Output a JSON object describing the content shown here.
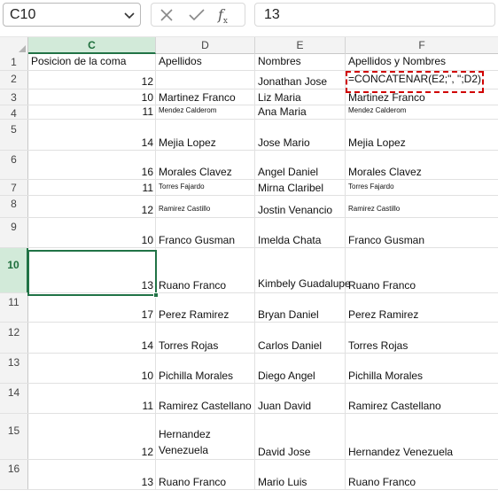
{
  "namebox": {
    "value": "C10"
  },
  "formula_bar": {
    "value": "13",
    "fx_label": "fx"
  },
  "columns": [
    "C",
    "D",
    "E",
    "F"
  ],
  "active_column": "C",
  "active_row": "10",
  "rows": [
    {
      "num": "1",
      "C": "Posicion de la coma",
      "D": "Apellidos",
      "E": "Nombres",
      "F": "Apellidos y Nombres"
    },
    {
      "num": "2",
      "C": "12",
      "D": "",
      "E": "Jonathan Jose",
      "F": "=CONCATENAR(E2;\", \";D2)"
    },
    {
      "num": "3",
      "C": "10",
      "D": " Martinez Franco",
      "E": "Liz Maria",
      "F": "Martinez Franco"
    },
    {
      "num": "4",
      "C": "11",
      "D": "Mendez Calderom",
      "E": "Ana Maria",
      "F": "Mendez Calderom"
    },
    {
      "num": "5",
      "C": "14",
      "D": "Mejia Lopez",
      "E": "Jose Mario",
      "F": "Mejia Lopez"
    },
    {
      "num": "6",
      "C": "16",
      "D": "Morales Clavez",
      "E": "Angel Daniel",
      "F": "Morales Clavez"
    },
    {
      "num": "7",
      "C": "11",
      "D": "Torres Fajardo",
      "E": "Mirna Claribel",
      "F": "Torres Fajardo"
    },
    {
      "num": "8",
      "C": "12",
      "D": "Ramirez Castillo",
      "E": "Jostin Venancio",
      "F": "Ramirez Castillo"
    },
    {
      "num": "9",
      "C": "10",
      "D": "Franco Gusman",
      "E": "Imelda Chata",
      "F": "Franco Gusman"
    },
    {
      "num": "10",
      "C": "13",
      "D": "Ruano Franco",
      "E": "Kimbely Guadalupe",
      "F": "Ruano Franco"
    },
    {
      "num": "11",
      "C": "17",
      "D": "Perez Ramirez",
      "E": "Bryan Daniel",
      "F": "Perez Ramirez"
    },
    {
      "num": "12",
      "C": "14",
      "D": "Torres Rojas",
      "E": "Carlos Daniel",
      "F": "Torres Rojas"
    },
    {
      "num": "13",
      "C": "10",
      "D": "Pichilla Morales",
      "E": "Diego Angel",
      "F": "Pichilla Morales"
    },
    {
      "num": "14",
      "C": "11",
      "D": "Ramirez Castellano",
      "E": "Juan David",
      "F": "Ramirez Castellano"
    },
    {
      "num": "15",
      "C": "12",
      "D": "Hernandez Venezuela",
      "E": "David Jose",
      "F": "Hernandez Venezuela"
    },
    {
      "num": "16",
      "C": "13",
      "D": "Ruano Franco",
      "E": "Mario Luis",
      "F": "Ruano Franco"
    }
  ]
}
